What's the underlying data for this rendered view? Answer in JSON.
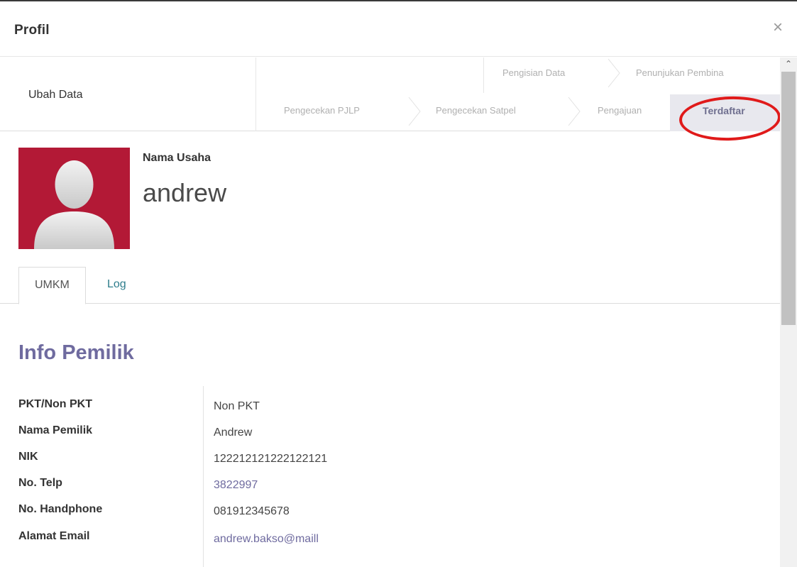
{
  "dialog": {
    "title": "Profil",
    "close_symbol": "×"
  },
  "actions": {
    "edit": "Ubah Data"
  },
  "statusbar": {
    "top_steps": [
      "Pengisian Data",
      "Penunjukan Pembina"
    ],
    "bottom_steps": [
      "Pengecekan PJLP",
      "Pengecekan Satpel",
      "Pengajuan"
    ],
    "active_step": "Terdaftar",
    "highlight_color": "#e01a1a"
  },
  "header": {
    "label": "Nama Usaha",
    "name": "andrew",
    "avatar_color": "#b31936"
  },
  "tabs": [
    "UMKM",
    "Log"
  ],
  "section": {
    "title": "Info Pemilik",
    "title_color": "#6f6b9f"
  },
  "fields": [
    {
      "label": "PKT/Non PKT",
      "value": "Non PKT"
    },
    {
      "label": "Nama Pemilik",
      "value": "Andrew"
    },
    {
      "label": "NIK",
      "value": "122212121222122121"
    },
    {
      "label": "No. Telp",
      "value": "3822997"
    },
    {
      "label": "No. Handphone",
      "value": "081912345678"
    },
    {
      "label": "Alamat Email",
      "value": "andrew.bakso@maill"
    }
  ],
  "icons": {
    "close": "close-icon",
    "avatar": "user-silhouette-icon",
    "scroll_up": "chevron-up-icon"
  }
}
